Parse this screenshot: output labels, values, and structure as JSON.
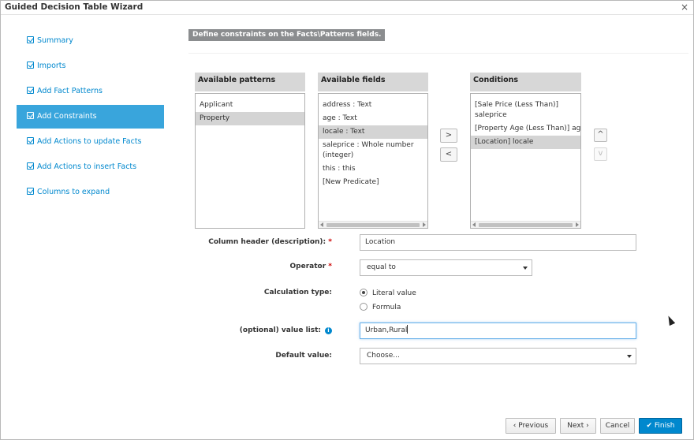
{
  "window": {
    "title": "Guided Decision Table Wizard",
    "close_glyph": "×"
  },
  "sidebar": {
    "items": [
      {
        "label": "Summary",
        "active": false
      },
      {
        "label": "Imports",
        "active": false
      },
      {
        "label": "Add Fact Patterns",
        "active": false
      },
      {
        "label": "Add Constraints",
        "active": true
      },
      {
        "label": "Add Actions to update Facts",
        "active": false
      },
      {
        "label": "Add Actions to insert Facts",
        "active": false
      },
      {
        "label": "Columns to expand",
        "active": false
      }
    ]
  },
  "banner": "Define constraints on the Facts\\Patterns fields.",
  "patterns": {
    "header": "Available patterns",
    "items": [
      "Applicant",
      "Property"
    ],
    "selected": 1
  },
  "fields": {
    "header": "Available fields",
    "items": [
      "address : Text",
      "age : Text",
      "locale : Text",
      "saleprice : Whole number (integer)",
      "this : this",
      "[New Predicate]"
    ],
    "selected": 2
  },
  "conditions": {
    "header": "Conditions",
    "items": [
      "[Sale Price (Less Than)] saleprice",
      "[Property Age (Less Than)] age",
      "[Location] locale"
    ],
    "selected": 2
  },
  "move": {
    "right": ">",
    "left": "<"
  },
  "order": {
    "up": "^",
    "down": "v"
  },
  "form": {
    "column_header": {
      "label": "Column header (description):",
      "required": "*",
      "value": "Location"
    },
    "operator": {
      "label": "Operator",
      "required": "*",
      "value": "equal to"
    },
    "calc_type": {
      "label": "Calculation type:",
      "options": [
        "Literal value",
        "Formula"
      ],
      "selected": 0
    },
    "value_list": {
      "label": "(optional) value list:",
      "value": "Urban,Rural",
      "info": "i"
    },
    "default_value": {
      "label": "Default value:",
      "value": "Choose..."
    }
  },
  "footer": {
    "previous": "Previous",
    "next": "Next",
    "cancel": "Cancel",
    "finish": "Finish",
    "accent": "#0088ce"
  }
}
